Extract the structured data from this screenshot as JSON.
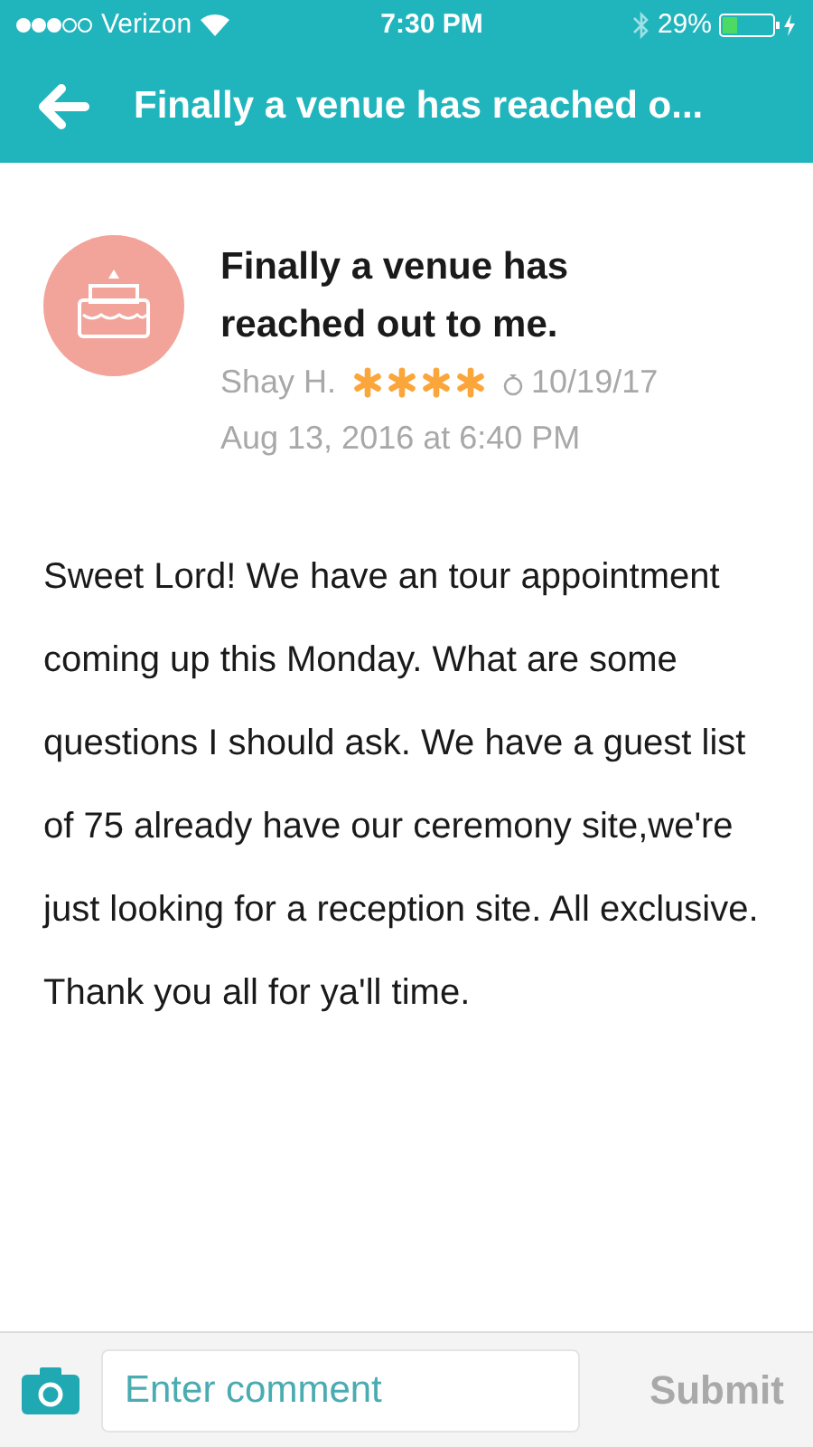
{
  "status_bar": {
    "carrier": "Verizon",
    "time": "7:30 PM",
    "battery": "29%"
  },
  "header": {
    "title": "Finally a venue has reached o..."
  },
  "post": {
    "title": "Finally a venue has reached out to me.",
    "author": "Shay H.",
    "stars": 4,
    "wedding_date": "10/19/17",
    "posted": "Aug 13, 2016 at 6:40 PM",
    "body": "Sweet Lord! We have an tour appointment coming up this Monday. What are some questions I should ask. We have a guest list of 75 already have our ceremony site,we're just looking for a reception site. All exclusive. Thank you all for ya'll time."
  },
  "comment_bar": {
    "placeholder": "Enter comment",
    "submit": {
      "label": "Submit",
      "disabled": true
    }
  }
}
